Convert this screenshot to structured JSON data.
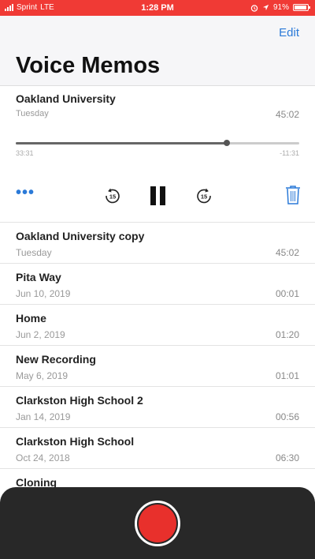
{
  "status_bar": {
    "carrier": "Sprint",
    "network": "LTE",
    "time": "1:28 PM",
    "battery": "91%"
  },
  "header": {
    "edit_label": "Edit",
    "title": "Voice Memos"
  },
  "player": {
    "name": "Oakland University",
    "date": "Tuesday",
    "duration": "45:02",
    "elapsed": "33:31",
    "remaining": "-11:31",
    "progress": 0.7445,
    "more_label": "•••",
    "skip_back_label": "15",
    "skip_forward_label": "15"
  },
  "memos": [
    {
      "name": "Oakland University copy",
      "date": "Tuesday",
      "duration": "45:02"
    },
    {
      "name": "Pita Way",
      "date": "Jun 10, 2019",
      "duration": "00:01"
    },
    {
      "name": "Home",
      "date": "Jun 2, 2019",
      "duration": "01:20"
    },
    {
      "name": "New Recording",
      "date": "May 6, 2019",
      "duration": "01:01"
    },
    {
      "name": "Clarkston High School 2",
      "date": "Jan 14, 2019",
      "duration": "00:56"
    },
    {
      "name": "Clarkston High School",
      "date": "Oct 24, 2018",
      "duration": "06:30"
    },
    {
      "name": "Cloning",
      "date": "",
      "duration": ""
    }
  ],
  "colors": {
    "status_bar": "#f03a35",
    "accent": "#2b7ad8",
    "record": "#e8302c",
    "record_panel": "#282828"
  },
  "icons": {
    "more": "ellipsis-icon",
    "skip_back": "skip-back-15-icon",
    "pause": "pause-icon",
    "skip_forward": "skip-forward-15-icon",
    "trash": "trash-icon",
    "record": "record-icon"
  }
}
